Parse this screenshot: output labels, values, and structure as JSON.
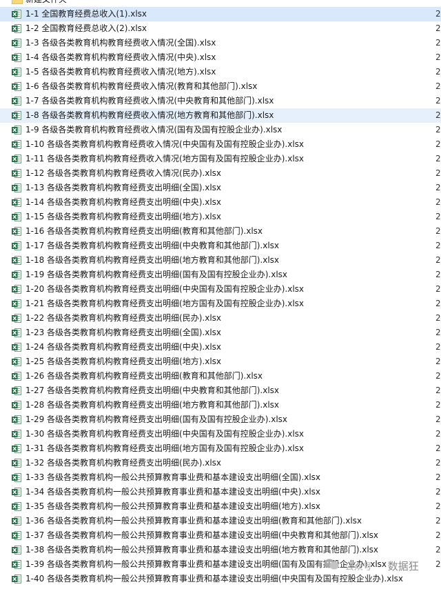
{
  "folder": {
    "name": "新建文件夹"
  },
  "files": [
    {
      "name": "1-1 全国教育经费总收入(1).xlsx",
      "trail": "2"
    },
    {
      "name": "1-2 全国教育经费总收入(2).xlsx",
      "trail": "2"
    },
    {
      "name": "1-3 各级各类教育机构教育经费收入情况(全国).xlsx",
      "trail": "2"
    },
    {
      "name": "1-4 各级各类教育机构教育经费收入情况(中央).xlsx",
      "trail": "2"
    },
    {
      "name": "1-5 各级各类教育机构教育经费收入情况(地方).xlsx",
      "trail": "2"
    },
    {
      "name": "1-6 各级各类教育机构教育经费收入情况(教育和其他部门).xlsx",
      "trail": "2"
    },
    {
      "name": "1-7 各级各类教育机构教育经费收入情况(中央教育和其他部门).xlsx",
      "trail": "2"
    },
    {
      "name": "1-8 各级各类教育机构教育经费收入情况(地方教育和其他部门).xlsx",
      "trail": "2"
    },
    {
      "name": "1-9 各级各类教育机构教育经费收入情况(国有及国有控股企业办).xlsx",
      "trail": "2"
    },
    {
      "name": "1-10 各级各类教育机构教育经费收入情况(中央国有及国有控股企业办).xlsx",
      "trail": "2"
    },
    {
      "name": "1-11 各级各类教育机构教育经费收入情况(地方国有及国有控股企业办).xlsx",
      "trail": "2"
    },
    {
      "name": "1-12 各级各类教育机构教育经费收入情况(民办).xlsx",
      "trail": "2"
    },
    {
      "name": "1-13 各级各类教育机构教育经费支出明细(全国).xlsx",
      "trail": "2"
    },
    {
      "name": "1-14 各级各类教育机构教育经费支出明细(中央).xlsx",
      "trail": "2"
    },
    {
      "name": "1-15 各级各类教育机构教育经费支出明细(地方).xlsx",
      "trail": "2"
    },
    {
      "name": "1-16 各级各类教育机构教育经费支出明细(教育和其他部门).xlsx",
      "trail": "2"
    },
    {
      "name": "1-17 各级各类教育机构教育经费支出明细(中央教育和其他部门).xlsx",
      "trail": "2"
    },
    {
      "name": "1-18 各级各类教育机构教育经费支出明细(地方教育和其他部门).xlsx",
      "trail": "2"
    },
    {
      "name": "1-19 各级各类教育机构教育经费支出明细(国有及国有控股企业办).xlsx",
      "trail": "2"
    },
    {
      "name": "1-20 各级各类教育机构教育经费支出明细(中央国有及国有控股企业办).xlsx",
      "trail": "2"
    },
    {
      "name": "1-21 各级各类教育机构教育经费支出明细(地方国有及国有控股企业办).xlsx",
      "trail": "2"
    },
    {
      "name": "1-22 各级各类教育机构教育经费支出明细(民办).xlsx",
      "trail": "2"
    },
    {
      "name": "1-23 各级各类教育机构教育经费支出明细(全国).xlsx",
      "trail": "2"
    },
    {
      "name": "1-24 各级各类教育机构教育经费支出明细(中央).xlsx",
      "trail": "2"
    },
    {
      "name": "1-25 各级各类教育机构教育经费支出明细(地方).xlsx",
      "trail": "2"
    },
    {
      "name": "1-26 各级各类教育机构教育经费支出明细(教育和其他部门).xlsx",
      "trail": "2"
    },
    {
      "name": "1-27 各级各类教育机构教育经费支出明细(中央教育和其他部门).xlsx",
      "trail": "2"
    },
    {
      "name": "1-28 各级各类教育机构教育经费支出明细(地方教育和其他部门).xlsx",
      "trail": "2"
    },
    {
      "name": "1-29 各级各类教育机构教育经费支出明细(国有及国有控股企业办).xlsx",
      "trail": "2"
    },
    {
      "name": "1-30 各级各类教育机构教育经费支出明细(中央国有及国有控股企业办).xlsx",
      "trail": "2"
    },
    {
      "name": "1-31 各级各类教育机构教育经费支出明细(地方国有及国有控股企业办).xlsx",
      "trail": "2"
    },
    {
      "name": "1-32 各级各类教育机构教育经费支出明细(民办).xlsx",
      "trail": "2"
    },
    {
      "name": "1-33 各级各类教育机构一般公共预算教育事业费和基本建设支出明细(全国).xlsx",
      "trail": "2"
    },
    {
      "name": "1-34 各级各类教育机构一般公共预算教育事业费和基本建设支出明细(中央).xlsx",
      "trail": "2"
    },
    {
      "name": "1-35 各级各类教育机构一般公共预算教育事业费和基本建设支出明细(地方).xlsx",
      "trail": "2"
    },
    {
      "name": "1-36 各级各类教育机构一般公共预算教育事业费和基本建设支出明细(教育和其他部门).xlsx",
      "trail": "2"
    },
    {
      "name": "1-37 各级各类教育机构一般公共预算教育事业费和基本建设支出明细(中央教育和其他部门).xlsx",
      "trail": "2"
    },
    {
      "name": "1-38 各级各类教育机构一般公共预算教育事业费和基本建设支出明细(地方教育和其他部门).xlsx",
      "trail": "2"
    },
    {
      "name": "1-39 各级各类教育机构一般公共预算教育事业费和基本建设支出明细(国有及国有控股企业办).xlsx",
      "trail": "2"
    },
    {
      "name": "1-40 各级各类教育机构一般公共预算教育事业费和基本建设支出明细(中央国有及国有控股企业办).xlsx",
      "trail": ""
    }
  ],
  "watermark": {
    "sub": "公众号",
    "text": "数据狂"
  },
  "colors": {
    "selected_bg": "#d9e8fb",
    "hover_bg": "#e5f0fc",
    "excel_green": "#1e7145",
    "folder_yellow": "#f3c34a"
  }
}
